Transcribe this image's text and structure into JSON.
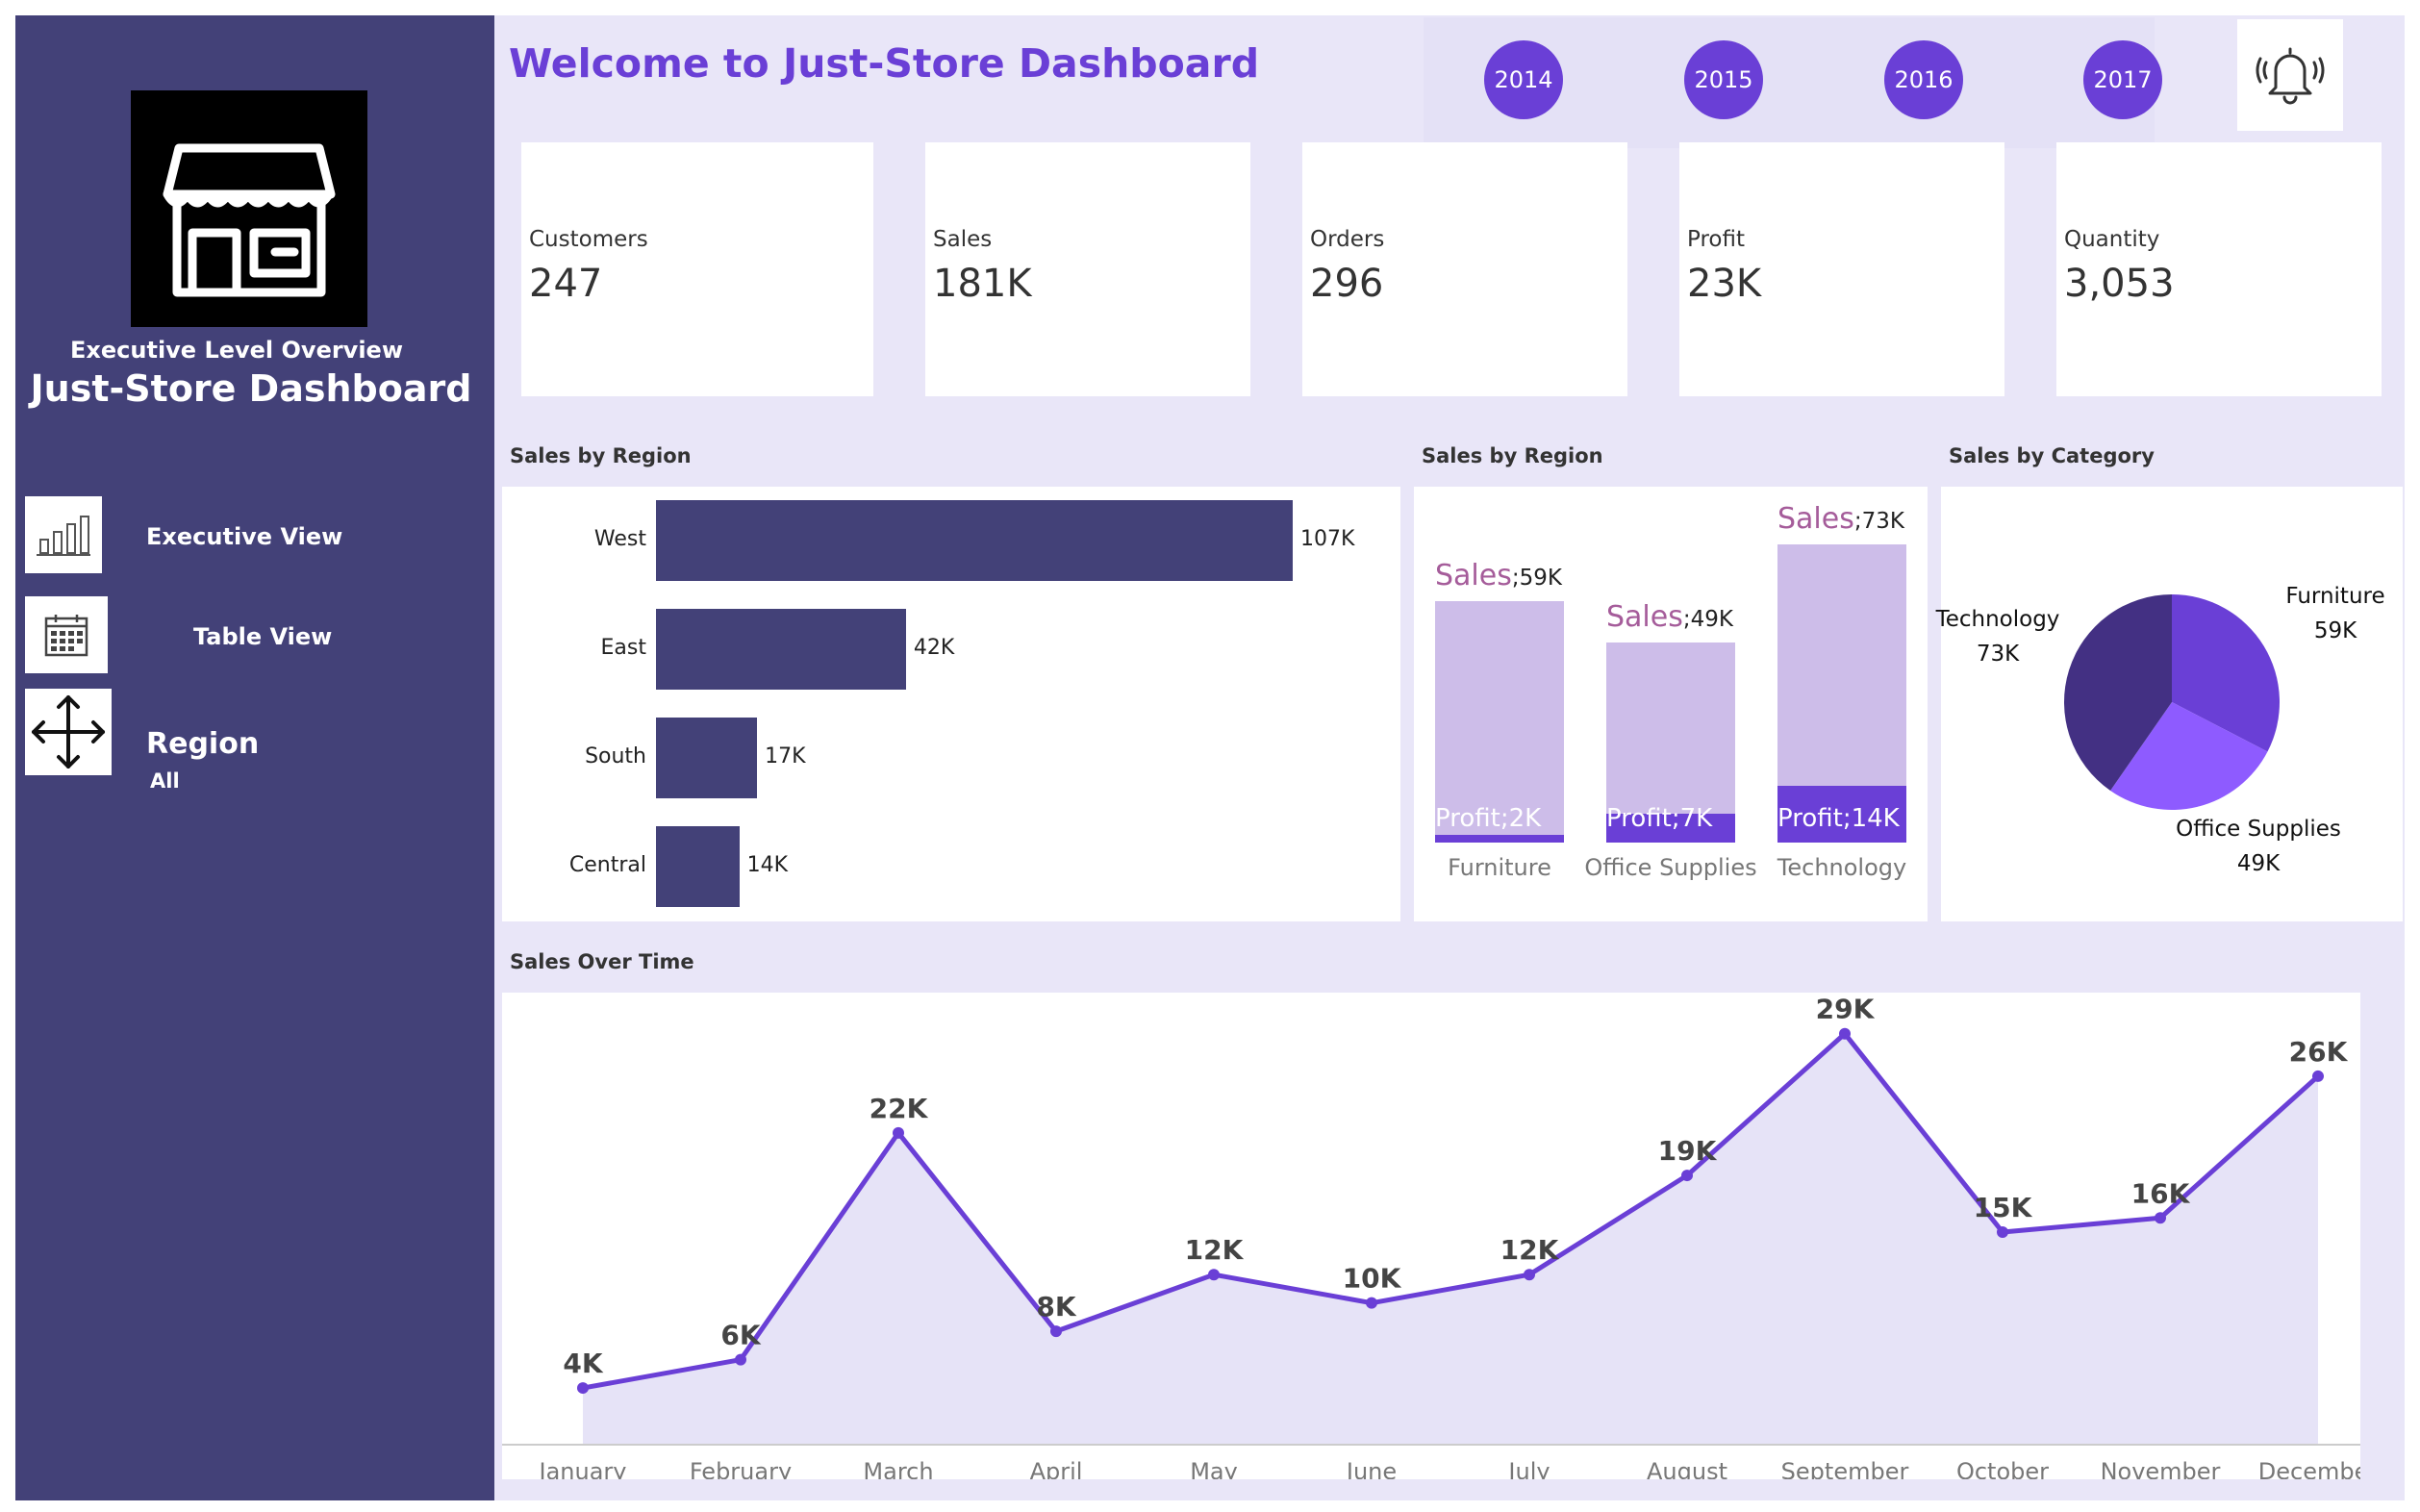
{
  "sidebar": {
    "subtitle": "Executive Level Overview",
    "title": "Just-Store Dashboard",
    "nav": [
      {
        "label": "Executive View",
        "icon": "bar-chart-icon"
      },
      {
        "label": "Table View",
        "icon": "calendar-icon"
      }
    ],
    "region": {
      "label": "Region",
      "value": "All",
      "icon": "move-arrows-icon"
    }
  },
  "header": {
    "welcome": "Welcome to Just-Store Dashboard",
    "years": [
      "2014",
      "2015",
      "2016",
      "2017"
    ],
    "bell_icon": "bell-icon"
  },
  "kpis": [
    {
      "label": "Customers",
      "value": "247"
    },
    {
      "label": "Sales",
      "value": "181K"
    },
    {
      "label": "Orders",
      "value": "296"
    },
    {
      "label": "Profit",
      "value": "23K"
    },
    {
      "label": "Quantity",
      "value": "3,053"
    }
  ],
  "colors": {
    "sidebar": "#434178",
    "accent": "#6a3fd6",
    "background": "#e9e6f8",
    "light_purple": "#cdbde9",
    "pie_dark": "#433083",
    "pie_mid": "#6a3fd6",
    "pie_light": "#8e5bff"
  },
  "chart_data": [
    {
      "title": "Sales by Region",
      "type": "bar",
      "orientation": "horizontal",
      "categories": [
        "West",
        "East",
        "South",
        "Central"
      ],
      "values": [
        107,
        42,
        17,
        14
      ],
      "value_labels": [
        "107K",
        "42K",
        "17K",
        "14K"
      ],
      "xlim": [
        0,
        107
      ]
    },
    {
      "title": "Sales by Region",
      "type": "bar",
      "stacked": true,
      "categories": [
        "Furniture",
        "Office Supplies",
        "Technology"
      ],
      "series": [
        {
          "name": "Sales",
          "values": [
            59,
            49,
            73
          ],
          "labels": [
            "59K",
            "49K",
            "73K"
          ]
        },
        {
          "name": "Profit",
          "values": [
            2,
            7,
            14
          ],
          "labels": [
            "2K",
            "7K",
            "14K"
          ]
        }
      ],
      "ylim": [
        0,
        73
      ]
    },
    {
      "title": "Sales by Category",
      "type": "pie",
      "slices": [
        {
          "name": "Furniture",
          "value": 59,
          "label": "59K"
        },
        {
          "name": "Office Supplies",
          "value": 49,
          "label": "49K"
        },
        {
          "name": "Technology",
          "value": 73,
          "label": "73K"
        }
      ]
    },
    {
      "title": "Sales Over Time",
      "type": "area",
      "categories": [
        "January",
        "February",
        "March",
        "April",
        "May",
        "June",
        "July",
        "August",
        "September",
        "October",
        "November",
        "December"
      ],
      "values": [
        4,
        6,
        22,
        8,
        12,
        10,
        12,
        19,
        29,
        15,
        16,
        26
      ],
      "value_labels": [
        "4K",
        "6K",
        "22K",
        "8K",
        "12K",
        "10K",
        "12K",
        "19K",
        "29K",
        "15K",
        "16K",
        "26K"
      ],
      "ylim": [
        0,
        30
      ]
    }
  ]
}
